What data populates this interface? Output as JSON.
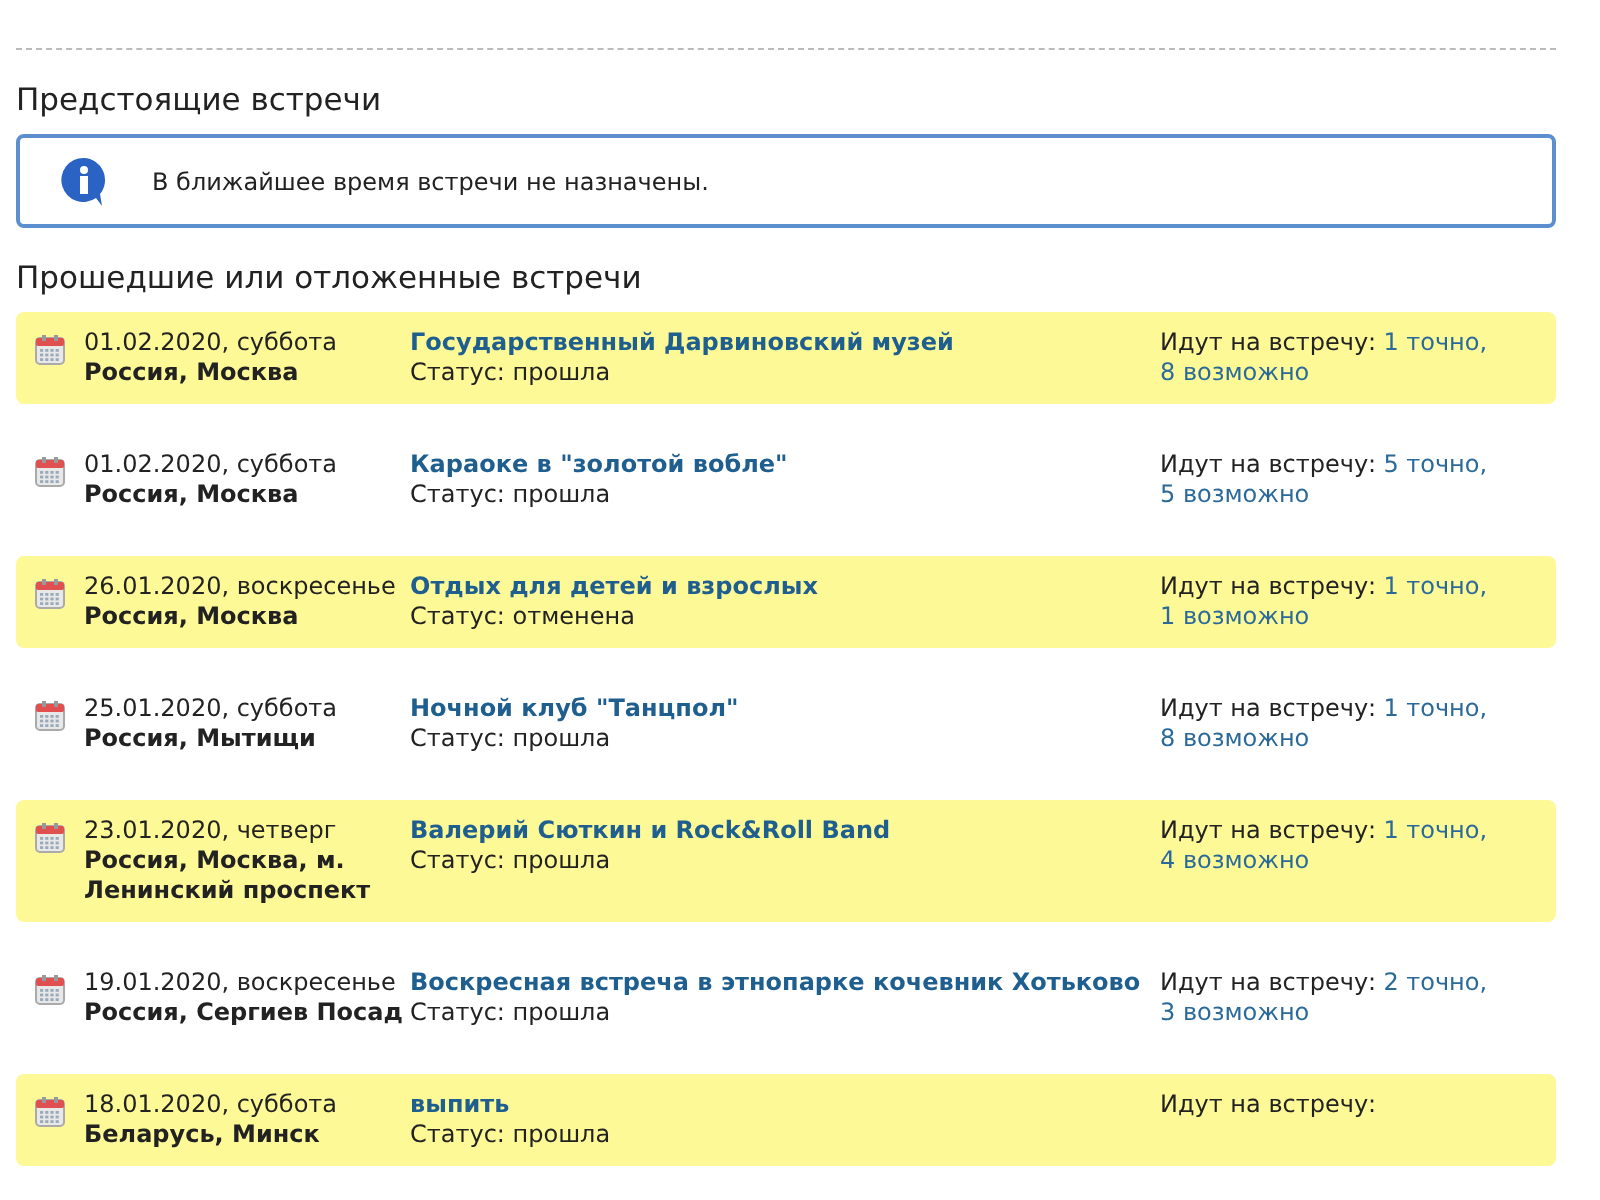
{
  "upcoming": {
    "heading": "Предстоящие встречи",
    "notice": "В ближайшее время встречи не назначены."
  },
  "past": {
    "heading": "Прошедшие или отложенные встречи",
    "rows": [
      {
        "highlighted": true,
        "date": "01.02.2020, суббота",
        "place": "Россия, Москва",
        "title": "Государственный Дарвиновский музей",
        "status": "Статус: прошла",
        "attending_label": "Идут на встречу:",
        "sure": "1 точно,",
        "maybe": "8 возможно"
      },
      {
        "highlighted": false,
        "date": "01.02.2020, суббота",
        "place": "Россия, Москва",
        "title": "Караоке в \"золотой вобле\"",
        "status": "Статус: прошла",
        "attending_label": "Идут на встречу:",
        "sure": "5 точно,",
        "maybe": "5 возможно"
      },
      {
        "highlighted": true,
        "date": "26.01.2020, воскресенье",
        "place": "Россия, Москва",
        "title": "Отдых для детей и взрослых",
        "status": "Статус: отменена",
        "attending_label": "Идут на встречу:",
        "sure": "1 точно,",
        "maybe": "1 возможно"
      },
      {
        "highlighted": false,
        "date": "25.01.2020, суббота",
        "place": "Россия, Мытищи",
        "title": "Ночной клуб \"Танцпол\"",
        "status": "Статус: прошла",
        "attending_label": "Идут на встречу:",
        "sure": "1 точно,",
        "maybe": "8 возможно"
      },
      {
        "highlighted": true,
        "date": "23.01.2020, четверг",
        "place": "Россия, Москва, м. Ленинский проспект",
        "title": "Валерий Сюткин и Rock&Roll Band",
        "status": "Статус: прошла",
        "attending_label": "Идут на встречу:",
        "sure": "1 точно,",
        "maybe": "4 возможно"
      },
      {
        "highlighted": false,
        "date": "19.01.2020, воскресенье",
        "place": "Россия, Сергиев Посад",
        "title": "Воскресная встреча в этнопарке кочевник Хотьково",
        "status": "Статус: прошла",
        "attending_label": "Идут на встречу:",
        "sure": "2 точно,",
        "maybe": "3 возможно"
      },
      {
        "highlighted": true,
        "date": "18.01.2020, суббота",
        "place": "Беларусь, Минск",
        "title": "выпить",
        "status": "Статус: прошла",
        "attending_label": "Идут на встречу:"
      }
    ]
  }
}
